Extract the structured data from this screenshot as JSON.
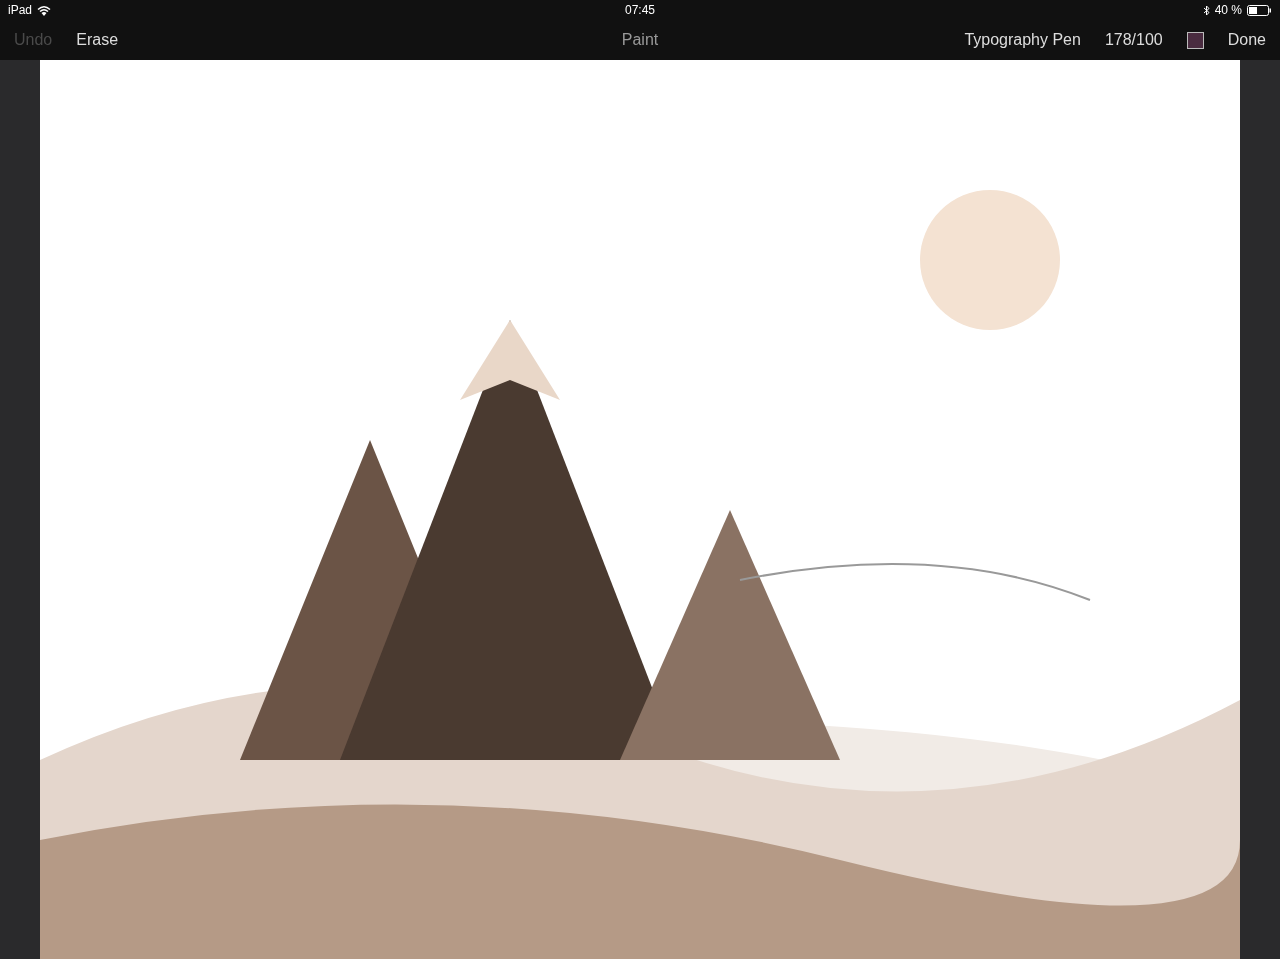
{
  "status_bar": {
    "device": "iPad",
    "time": "07:45",
    "battery": "40 %"
  },
  "toolbar": {
    "left": [
      {
        "label": "Undo",
        "disabled": true
      },
      {
        "label": "Erase",
        "disabled": false
      }
    ],
    "title": "Paint",
    "brush": "Typography Pen",
    "size": "178/100",
    "swatch": {
      "color": "#4a2c40"
    },
    "done": "Done"
  }
}
